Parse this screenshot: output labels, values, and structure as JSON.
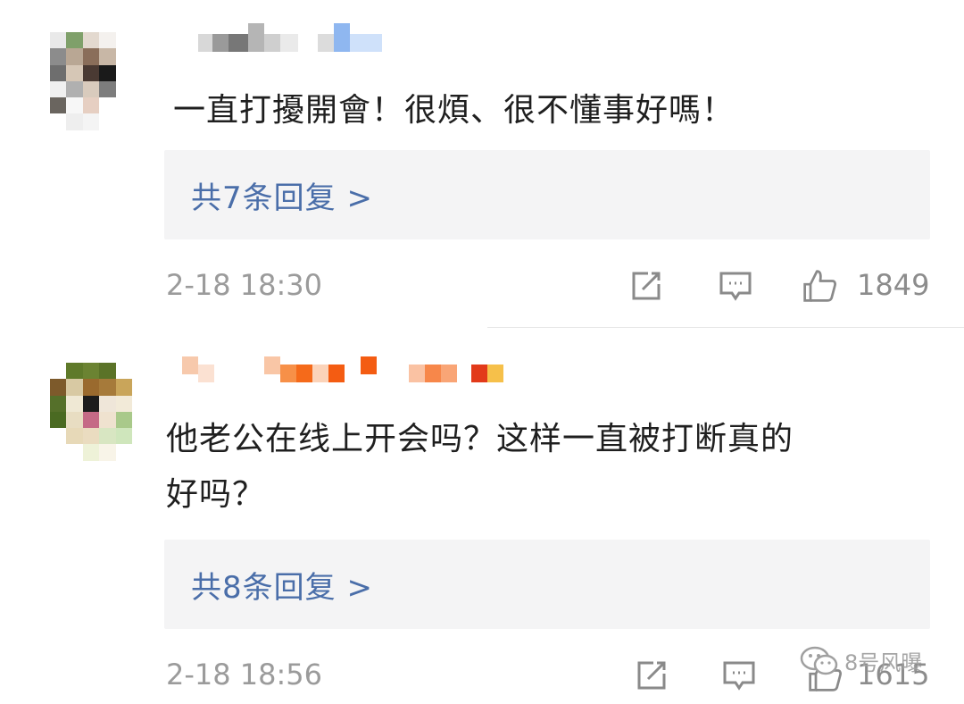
{
  "comments": [
    {
      "text": "一直打擾開會！很煩、很不懂事好嗎！",
      "reply_link": "共7条回复 >",
      "timestamp": "2-18 18:30",
      "likes": "1849"
    },
    {
      "text_line1": "他老公在线上开会吗？这样一直被打断真的",
      "text_line2": "好吗？",
      "reply_link": "共8条回复 >",
      "timestamp": "2-18 18:56",
      "likes": "1615"
    }
  ],
  "watermark": {
    "text": "8号风曝"
  },
  "icons": [
    "repost-icon",
    "comment-icon",
    "like-icon",
    "wechat-icon"
  ],
  "colors": {
    "link": "#4a6ea9",
    "reply_bg": "#f4f4f5",
    "meta": "#9b9b9b"
  }
}
